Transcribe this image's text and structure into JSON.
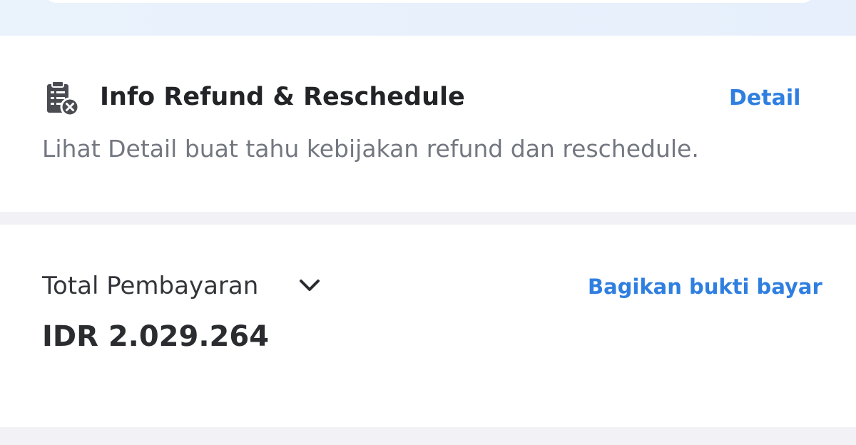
{
  "refund_section": {
    "icon": "document-cancel-icon",
    "title": "Info Refund & Reschedule",
    "detail_link": "Detail",
    "description": "Lihat Detail buat tahu kebijakan refund dan reschedule."
  },
  "payment_section": {
    "label": "Total Pembayaran",
    "expand_icon": "chevron-down-icon",
    "share_link": "Bagikan bukti bayar",
    "amount": "IDR 2.029.264"
  },
  "colors": {
    "link": "#2f7fe0",
    "title": "#232427",
    "muted": "#737780",
    "divider": "#f1f1f6",
    "header_tint": "#eaf2fc"
  }
}
